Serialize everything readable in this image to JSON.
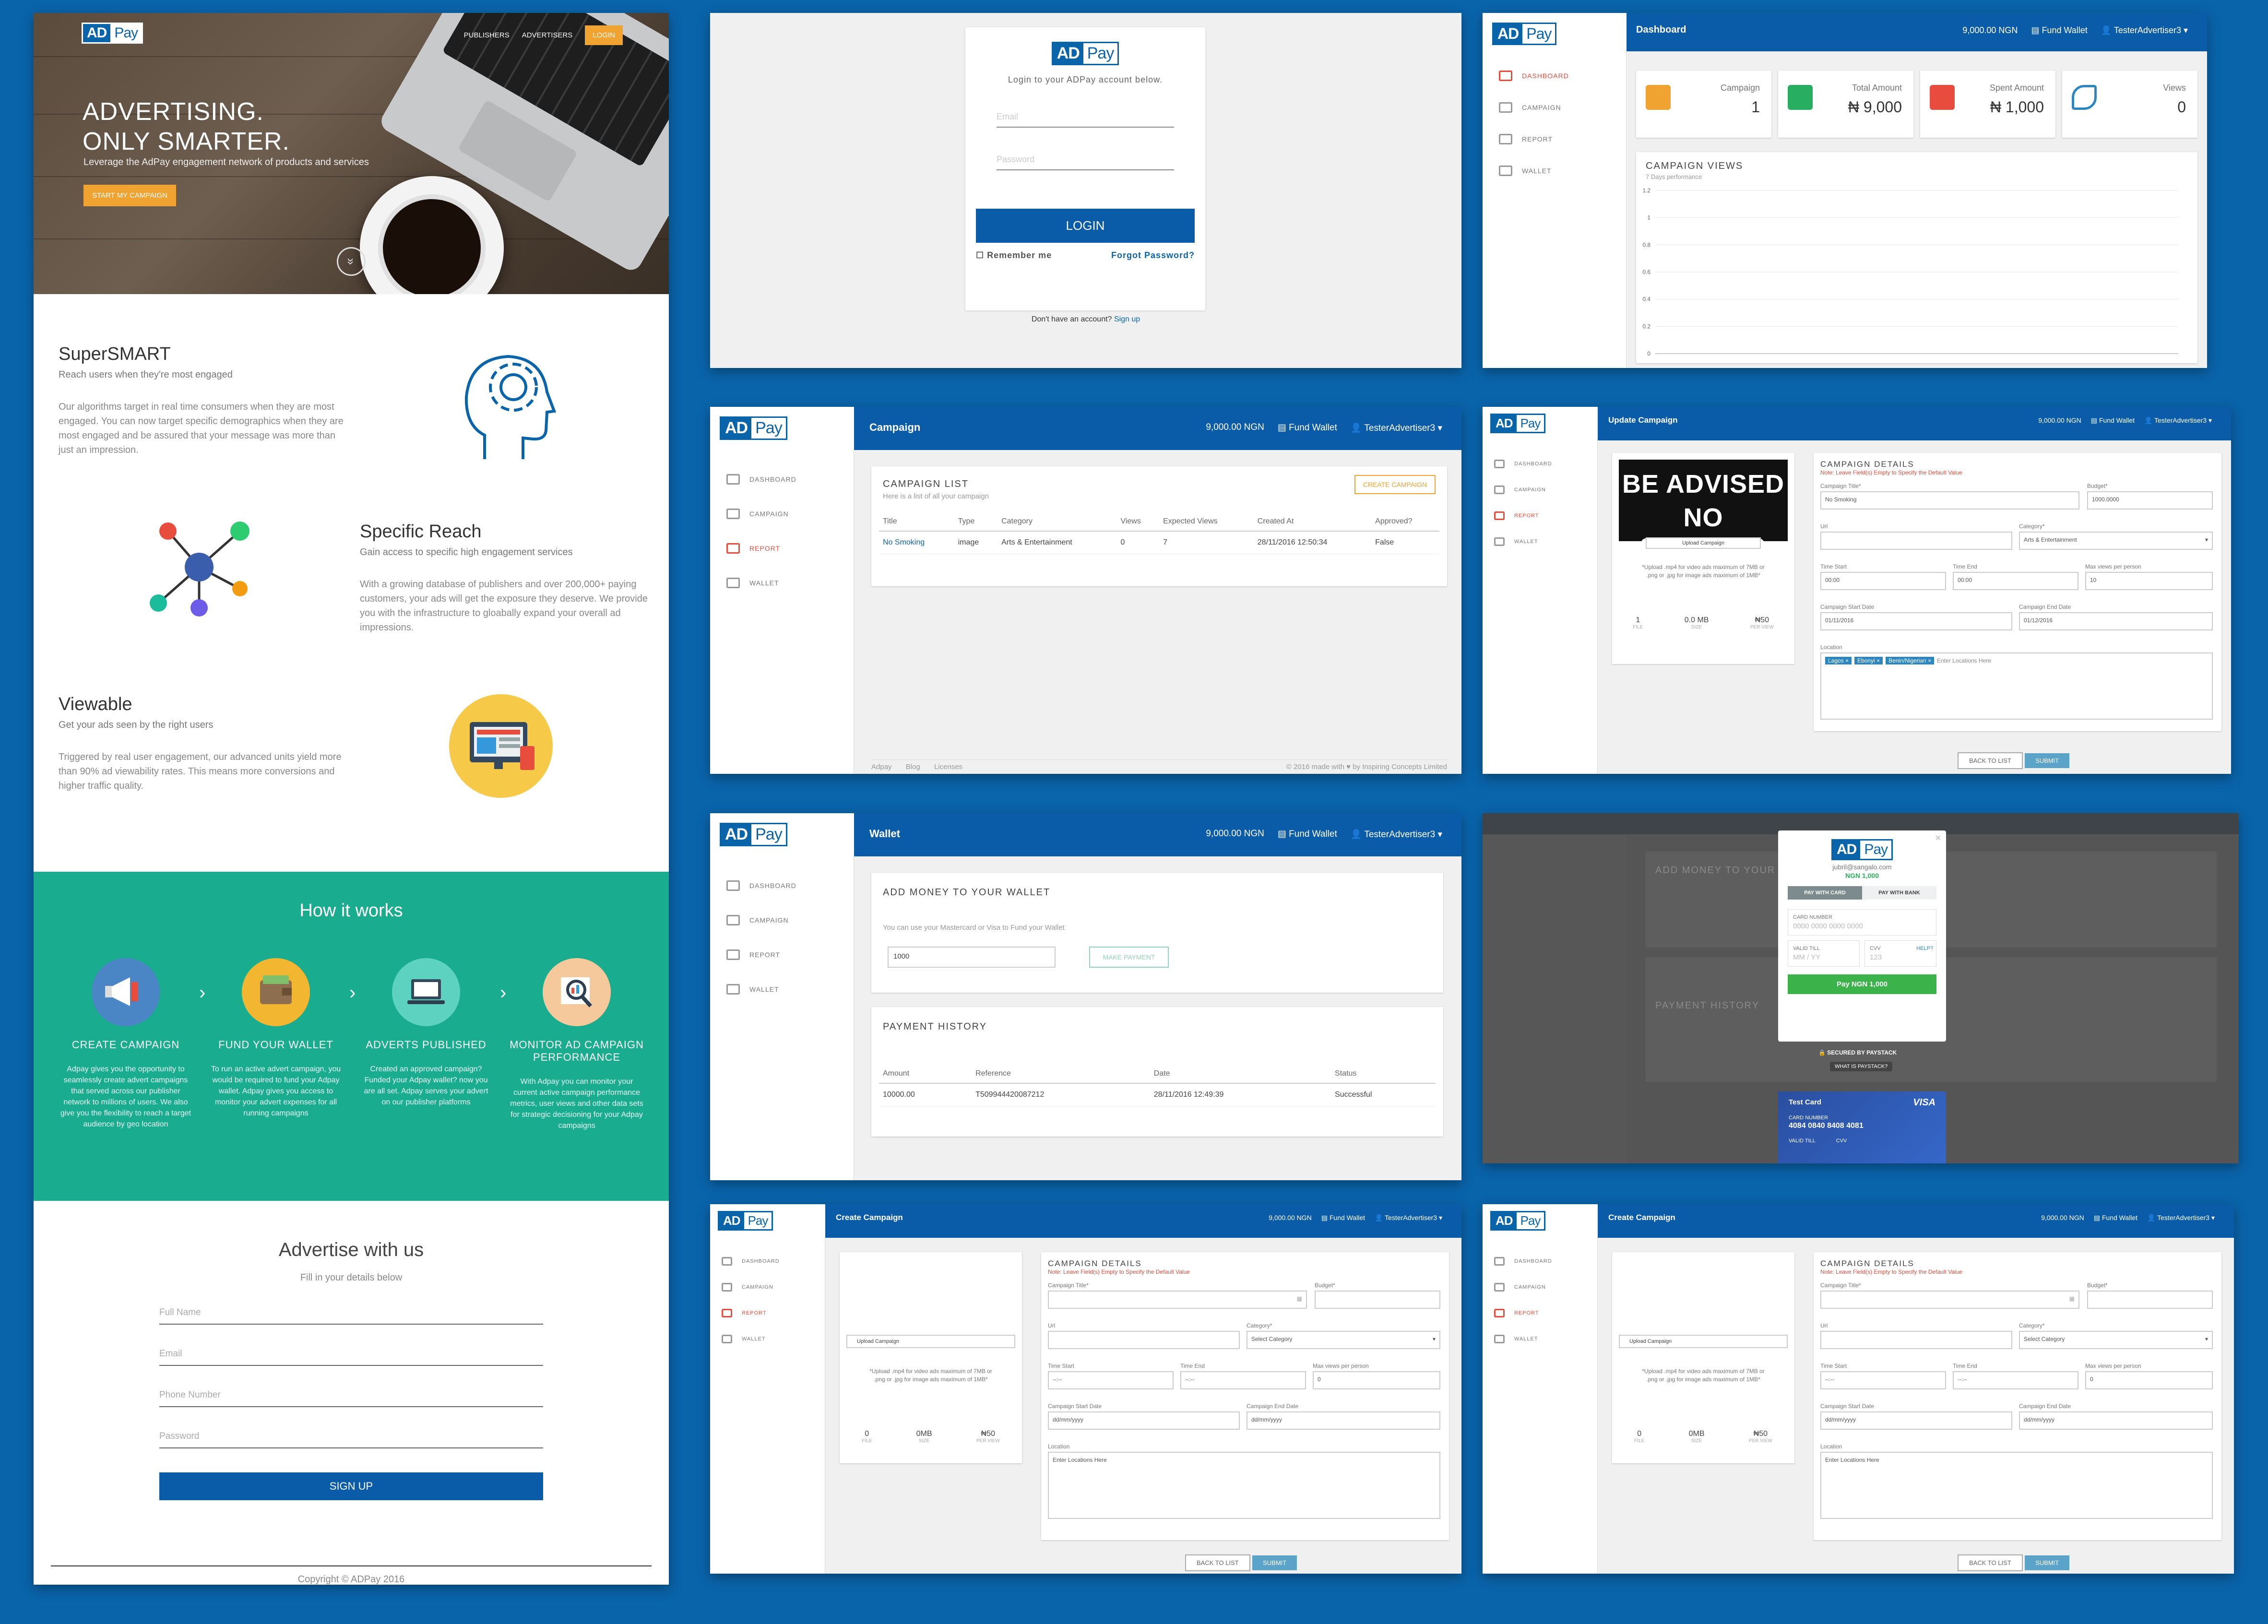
{
  "landing": {
    "nav": [
      "PUBLISHERS",
      "ADVERTISERS",
      "LOGIN"
    ],
    "logo_ad": "AD",
    "logo_pay": "Pay",
    "hero_title_1": "ADVERTISING.",
    "hero_title_2": "ONLY SMARTER.",
    "hero_tagline": "Leverage the AdPay engagement network of products and services",
    "hero_cta": "START MY CAMPAIGN",
    "hero_down": "»",
    "features": [
      {
        "title": "SuperSMART",
        "sub": "Reach users when they're most engaged",
        "body": "Our algorithms target in real time consumers when they are most engaged. You can now target specific demographics when they are most engaged and be assured that your message was more than just an impression."
      },
      {
        "title": "Specific Reach",
        "sub": "Gain access to specific high engagement services",
        "body": "With a growing database of publishers and over 200,000+ paying customers, your ads will get the exposure they deserve. We provide you with the infrastructure to gloabally expand your overall ad impressions."
      },
      {
        "title": "Viewable",
        "sub": "Get your ads seen by the right users",
        "body": "Triggered by real user engagement, our advanced units yield more than 90% ad viewability rates. This means more conversions and higher traffic quality."
      }
    ],
    "how_title": "How it works",
    "steps": [
      {
        "label": "CREATE CAMPAIGN",
        "desc": "Adpay gives you the opportunity to seamlessly create advert campaigns that served across our publisher network to millions of users. We also give you the flexibility to reach a target audience by geo location"
      },
      {
        "label": "FUND YOUR WALLET",
        "desc": "To run an active advert campaign, you would be required to fund your Adpay wallet. Adpay gives you access to monitor your advert expenses for all running campaigns"
      },
      {
        "label": "ADVERTS PUBLISHED",
        "desc": "Created an approved campaign? Funded your Adpay wallet? now you are all set. Adpay serves your advert on our publisher platforms"
      },
      {
        "label": "MONITOR AD CAMPAIGN PERFORMANCE",
        "desc": "With Adpay you can monitor your current active campaign performance metrics, user views and other data sets for strategic decisioning for your Adpay campaigns"
      }
    ],
    "step_arrow": "›",
    "advertise_title": "Advertise with us",
    "advertise_sub": "Fill in your details below",
    "fields": [
      "Full Name",
      "Email",
      "Phone Number",
      "Password"
    ],
    "signup": "SIGN UP",
    "footer": "Copyright © ADPay 2016"
  },
  "login": {
    "message": "Login to your ADPay account below.",
    "email_placeholder": "Email",
    "password_placeholder": "Password",
    "login_button": "LOGIN",
    "remember": "Remember me",
    "forgot": "Forgot Password?",
    "no_account": "Don't have an account?",
    "signup_link": "Sign up"
  },
  "app": {
    "balance": "9,000.00 NGN",
    "fund": "Fund Wallet",
    "user": "TesterAdvertiser3 ▾",
    "sidebar": [
      "DASHBOARD",
      "CAMPAIGN",
      "REPORT",
      "WALLET"
    ]
  },
  "dashboard": {
    "title": "Dashboard",
    "stats": [
      {
        "label": "Campaign",
        "value": "1",
        "color": "#f0a330"
      },
      {
        "label": "Total Amount",
        "value": "₦ 9,000",
        "color": "#27ae60"
      },
      {
        "label": "Spent Amount",
        "value": "₦ 1,000",
        "color": "#e74c3c"
      },
      {
        "label": "Views",
        "value": "0",
        "color": "#2e86c1"
      }
    ],
    "chart_title": "CAMPAIGN VIEWS",
    "chart_sub": "7 Days performance"
  },
  "chart_data": {
    "type": "line",
    "title": "CAMPAIGN VIEWS",
    "subtitle": "7 Days performance",
    "y_ticks": [
      "1.2",
      "1",
      "0.8",
      "0.6",
      "0.4",
      "0.2",
      "0"
    ],
    "ylim": [
      0,
      1.2
    ],
    "series": [],
    "grid": true
  },
  "campaign": {
    "title": "Campaign",
    "list_title": "CAMPAIGN LIST",
    "list_sub": "Here is a list of all your campaign",
    "create_button": "CREATE CAMPAIGN",
    "columns": [
      "Title",
      "Type",
      "Category",
      "Views",
      "Expected Views",
      "Created At",
      "Approved?"
    ],
    "rows": [
      [
        "No Smoking",
        "image",
        "Arts & Entertainment",
        "0",
        "7",
        "28/11/2016 12:50:34",
        "False"
      ]
    ],
    "footer_links": [
      "Adpay",
      "Blog",
      "Licenses"
    ],
    "footer_credit": "© 2016 made with ♥ by Inspiring Concepts Limited"
  },
  "update": {
    "title": "Update Campaign",
    "ad_line1": "BE ADVISED",
    "ad_line2": "NO SMOKING",
    "upload": "Upload Campaign",
    "upload_note": "*Upload .mp4 for video ads maximum of 7MB or .png or .jpg for image ads maximum of 1MB*",
    "meta": [
      {
        "v": "1",
        "l": "FILE"
      },
      {
        "v": "0.0 MB",
        "l": "SIZE"
      },
      {
        "v": "₦50",
        "l": "PER VIEW"
      }
    ],
    "details_title": "CAMPAIGN DETAILS",
    "details_note": "Note: Leave Field(s) Empty to Specify the Default Value",
    "campaign_title_label": "Campaign Title*",
    "campaign_title_value": "No Smoking",
    "budget_label": "Budget*",
    "budget_value": "1000.0000",
    "url_label": "Url",
    "category_label": "Category*",
    "category_value": "Arts & Entertainment",
    "time_start_label": "Time Start",
    "time_start_value": "00:00",
    "time_end_label": "Time End",
    "time_end_value": "00:00",
    "max_views_label": "Max views per person",
    "max_views_value": "10",
    "start_date_label": "Campaign Start Date",
    "start_date_value": "01/11/2016",
    "end_date_label": "Campaign End Date",
    "end_date_value": "01/12/2016",
    "location_label": "Location",
    "location_tags": [
      "Lagos ×",
      "Ebonyi ×",
      "Benin/Nigerian ×"
    ],
    "location_placeholder": "Enter Locations Here",
    "back": "BACK TO LIST",
    "submit": "SUBMIT"
  },
  "wallet": {
    "title": "Wallet",
    "add_title": "ADD MONEY TO YOUR WALLET",
    "add_sub": "You can use your Mastercard or Visa to Fund your Wallet",
    "amount": "1000",
    "make_payment": "MAKE PAYMENT",
    "history_title": "PAYMENT HISTORY",
    "columns": [
      "Amount",
      "Reference",
      "Date",
      "Status"
    ],
    "rows": [
      [
        "10000.00",
        "T509944420087212",
        "28/11/2016 12:49:39",
        "Successful"
      ]
    ]
  },
  "paystack": {
    "email": "jubril@sangalo.com",
    "amount": "NGN 1,000",
    "tab_card": "PAY WITH CARD",
    "tab_bank": "PAY WITH BANK",
    "card_number_label": "CARD NUMBER",
    "card_number_placeholder": "0000 0000 0000 0000",
    "valid_label": "VALID TILL",
    "valid_placeholder": "MM / YY",
    "cvv_label": "CVV",
    "cvv_placeholder": "123",
    "help": "HELP?",
    "pay_button": "Pay NGN 1,000",
    "secured": "SECURED BY PAYSTACK",
    "what_is": "WHAT IS PAYSTACK?",
    "test_card": "Test Card",
    "visa": "VISA",
    "tc_number_label": "CARD NUMBER",
    "tc_number": "4084 0840 8408 4081",
    "tc_valid": "VALID TILL",
    "tc_cvv": "CVV"
  },
  "create": {
    "title": "Create Campaign",
    "upload": "Upload Campaign",
    "upload_note": "*Upload .mp4 for video ads maximum of 7MB or .png or .jpg for image ads maximum of 1MB*",
    "meta": [
      {
        "v": "0",
        "l": "FILE"
      },
      {
        "v": "0MB",
        "l": "SIZE"
      },
      {
        "v": "₦50",
        "l": "PER VIEW"
      }
    ],
    "details_title": "CAMPAIGN DETAILS",
    "details_note": "Note: Leave Field(s) Empty to Specify the Default Value",
    "campaign_title_label": "Campaign Title*",
    "budget_label": "Budget*",
    "url_label": "Url",
    "category_label": "Category*",
    "category_placeholder": "Select Category",
    "time_start_label": "Time Start",
    "time_end_label": "Time End",
    "time_placeholder": "--:--",
    "max_views_label": "Max views per person",
    "max_views_value": "0",
    "start_date_label": "Campaign Start Date",
    "end_date_label": "Campaign End Date",
    "date_placeholder": "dd/mm/yyyy",
    "location_label": "Location",
    "location_placeholder": "Enter Locations Here",
    "back": "BACK TO LIST",
    "submit": "SUBMIT"
  }
}
